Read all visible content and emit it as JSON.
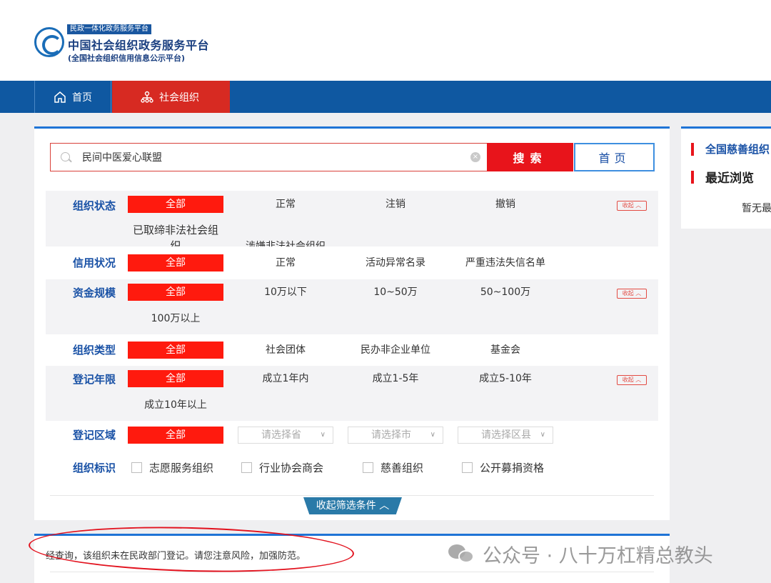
{
  "header": {
    "tagline": "民政一体化政务服务平台",
    "title": "中国社会组织政务服务平台",
    "subtitle": "(全国社会组织信用信息公示平台)"
  },
  "nav": {
    "home": "首页",
    "org": "社会组织"
  },
  "search": {
    "value": "民间中医爱心联盟",
    "clear": "×",
    "search_btn": "搜索",
    "home_btn": "首页"
  },
  "filters": {
    "status": {
      "label": "组织状态",
      "options": [
        "全部",
        "正常",
        "注销",
        "撤销",
        "已取缔非法社会组织",
        "涉嫌非法社会组织"
      ]
    },
    "credit": {
      "label": "信用状况",
      "options": [
        "全部",
        "正常",
        "活动异常名录",
        "严重违法失信名单"
      ]
    },
    "funds": {
      "label": "资金规模",
      "options": [
        "全部",
        "10万以下",
        "10~50万",
        "50~100万",
        "100万以上"
      ]
    },
    "type": {
      "label": "组织类型",
      "options": [
        "全部",
        "社会团体",
        "民办非企业单位",
        "基金会"
      ]
    },
    "years": {
      "label": "登记年限",
      "options": [
        "全部",
        "成立1年内",
        "成立1-5年",
        "成立5-10年",
        "成立10年以上"
      ]
    },
    "region": {
      "label": "登记区域",
      "all": "全部",
      "province": "请选择省",
      "city": "请选择市",
      "district": "请选择区县"
    },
    "marks": {
      "label": "组织标识",
      "options": [
        "志愿服务组织",
        "行业协会商会",
        "慈善组织",
        "公开募捐资格"
      ]
    },
    "collapse_tag": "收起 ︿",
    "collapse_btn": "收起筛选条件 ︿"
  },
  "sidebar": {
    "charity_link": "全国慈善组织",
    "recent": "最近浏览",
    "empty": "暂无最"
  },
  "result": {
    "message": "经查询，该组织未在民政部门登记。请您注意风险，加强防范。"
  },
  "watermark": "公众号 · 八十万杠精总教头",
  "colors": {
    "nav": "#0f58a1",
    "accent_red": "#ff1a0e",
    "link_blue": "#1a52a6"
  }
}
